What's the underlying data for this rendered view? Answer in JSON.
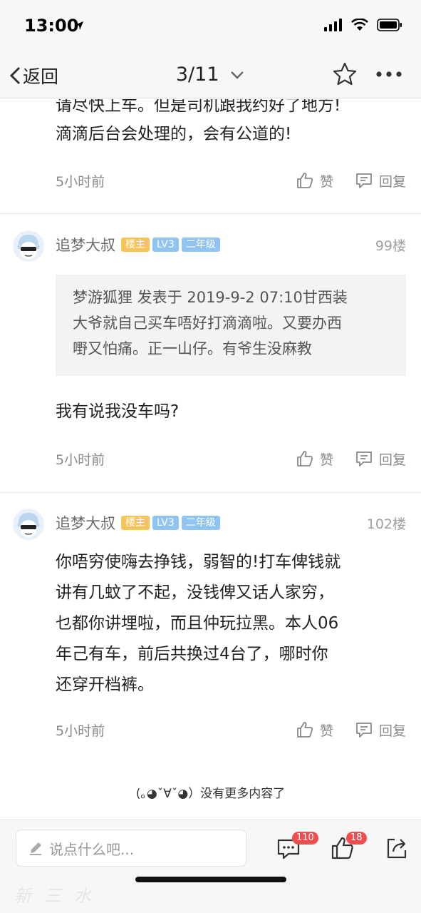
{
  "status_bar": {
    "time": "13:00"
  },
  "nav": {
    "back_label": "返回",
    "page_indicator": "3/11"
  },
  "posts": [
    {
      "text_lines": [
        "请尽快上车。但是司机跟我约好了地方!",
        "滴滴后台会处理的，会有公道的!"
      ],
      "time": "5小时前",
      "like_label": "赞",
      "reply_label": "回复"
    },
    {
      "author": "追梦大叔",
      "badge_owner": "楼主",
      "badge_level": "LV3",
      "badge_grade": "二年级",
      "floor": "99楼",
      "quote_lines": [
        "梦游狐狸 发表于 2019-9-2 07:10甘西装",
        "大爷就自己买车唔好打滴滴啦。又要办西",
        "嘢又怕痛。正一山仔。有爷生没麻教"
      ],
      "text_lines": [
        "我有说我没车吗?"
      ],
      "time": "5小时前",
      "like_label": "赞",
      "reply_label": "回复"
    },
    {
      "author": "追梦大叔",
      "badge_owner": "楼主",
      "badge_level": "LV3",
      "badge_grade": "二年级",
      "floor": "102楼",
      "text_lines": [
        "你唔穷使嗨去挣钱，弱智的!打车俾钱就",
        "讲有几蚊了不起，没钱俾又话人家穷，",
        "乜都你讲埋啦，而且仲玩拉黑。本人06",
        "年己有车，前后共换过4台了，哪时你",
        "还穿开档裤。"
      ],
      "time": "5小时前",
      "like_label": "赞",
      "reply_label": "回复"
    }
  ],
  "end_note": "(｡◕ˇ∀ˇ◕）没有更多内容了",
  "bottom_bar": {
    "input_placeholder": "说点什么吧...",
    "comment_count": "110",
    "like_count": "18"
  },
  "watermark": "新三水",
  "colors": {
    "badge_owner": "#f7c45a",
    "badge_level": "#8fc4f3",
    "count_badge": "#f04e4e"
  }
}
